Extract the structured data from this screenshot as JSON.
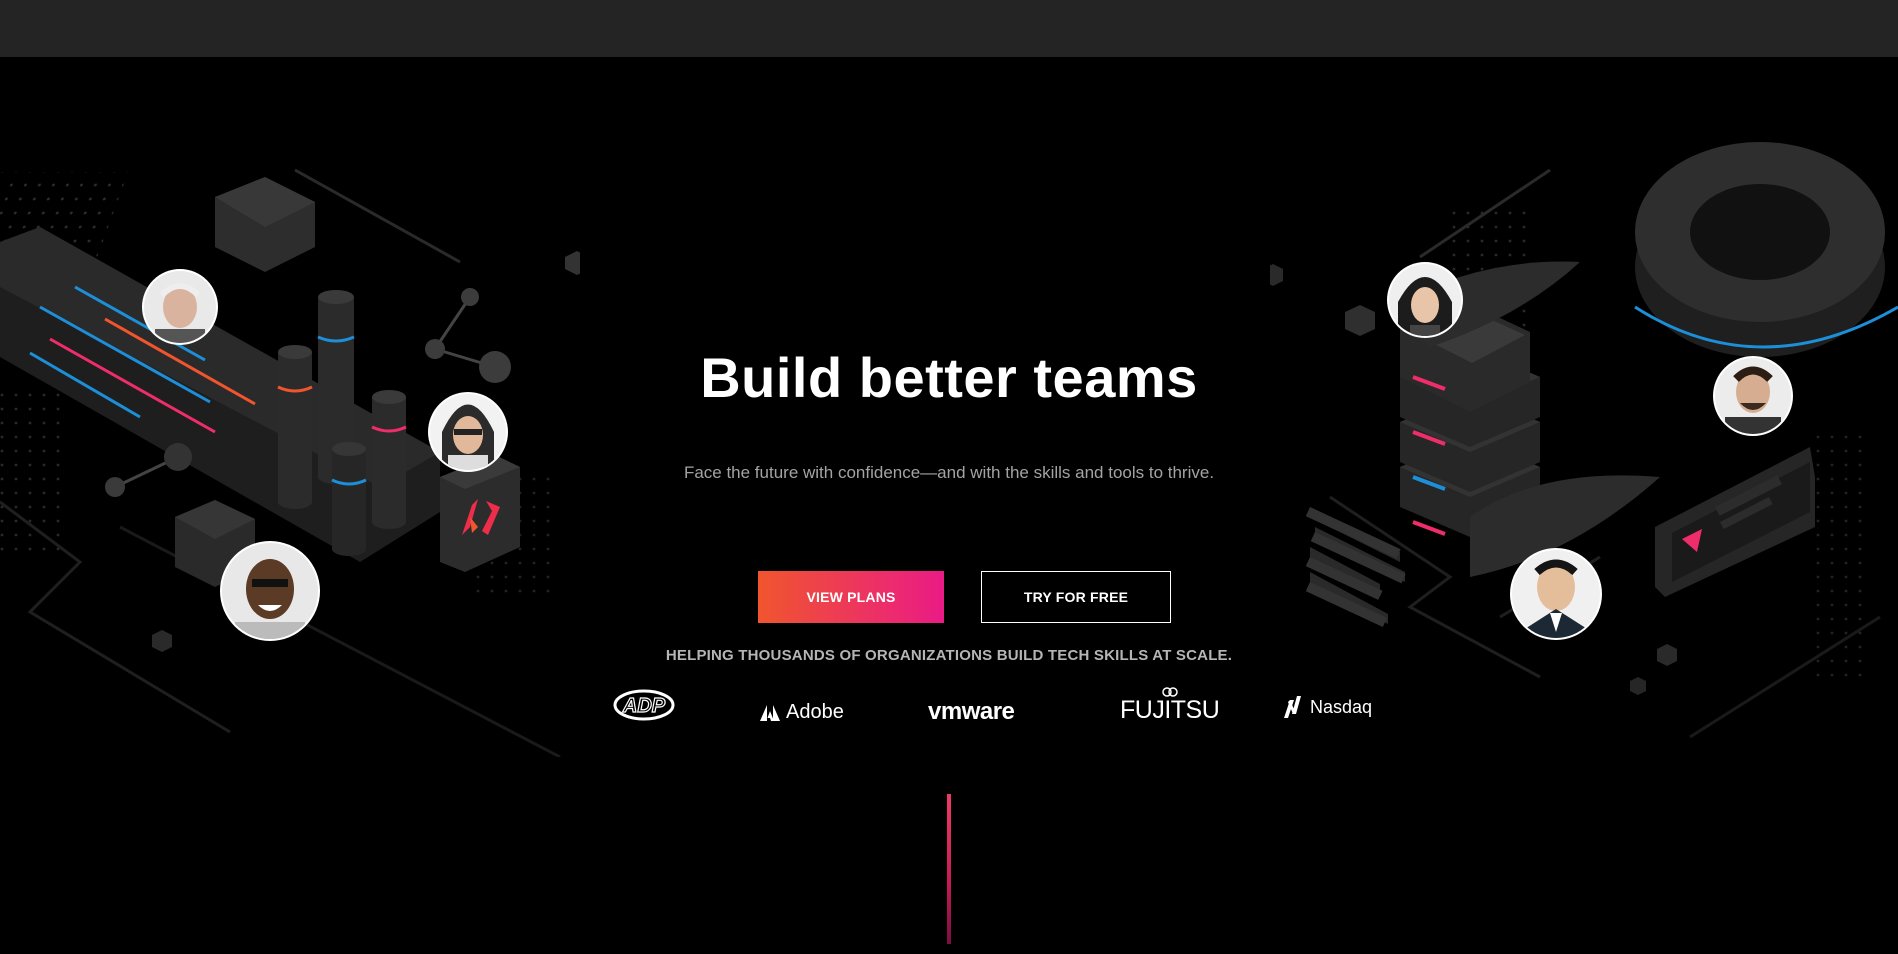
{
  "header": {
    "bg_color": "#242424"
  },
  "hero": {
    "title": "Build better teams",
    "subtitle": "Face the future with confidence—and with the skills and tools to thrive.",
    "primary_button_label": "VIEW PLANS",
    "secondary_button_label": "TRY FOR FREE",
    "tagline": "HELPING THOUSANDS OF ORGANIZATIONS BUILD TECH SKILLS AT SCALE.",
    "accent_gradient": [
      "#f0552e",
      "#ea1b86"
    ]
  },
  "logos": {
    "adp": "ADP",
    "adobe": "Adobe",
    "vmware": "vmware",
    "fujitsu": "FUJITSU",
    "nasdaq": "Nasdaq"
  },
  "icons": [
    "adp-logo-icon",
    "adobe-logo-icon",
    "fujitsu-logo-icon",
    "nasdaq-logo-icon",
    "pluralsight-logo-icon",
    "avatar-photo-icon"
  ]
}
